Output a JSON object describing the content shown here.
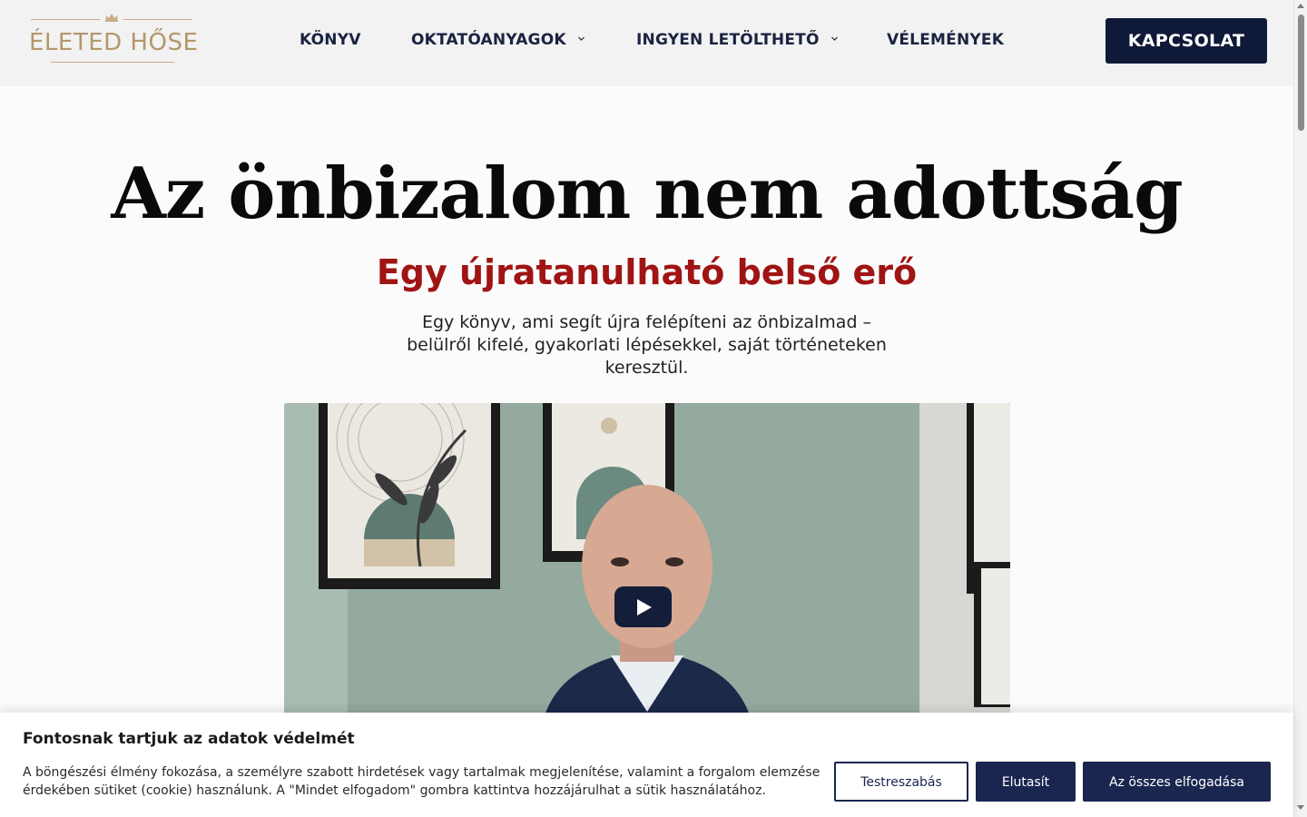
{
  "header": {
    "logo_text": "ÉLETED HŐSE",
    "nav": [
      {
        "label": "KÖNYV"
      },
      {
        "label": "OKTATÓANYAGOK"
      },
      {
        "label": "INGYEN LETÖLTHETŐ"
      },
      {
        "label": "VÉLEMÉNYEK"
      }
    ],
    "contact_label": "KAPCSOLAT"
  },
  "hero": {
    "title": "Az önbizalom nem adottság",
    "subtitle": "Egy újratanulható belső erő",
    "description": "Egy könyv, ami segít újra felépíteni az önbizalmad – belülről kifelé, gyakorlati lépésekkel, saját történeteken keresztül."
  },
  "cookie": {
    "title": "Fontosnak tartjuk az adatok védelmét",
    "text": "A böngészési élmény fokozása, a személyre szabott hirdetések vagy tartalmak megjelenítése, valamint a forgalom elemzése érdekében sütiket (cookie) használunk. A \"Mindet elfogadom\" gombra kattintva hozzájárulhat a sütik használatához.",
    "customize_label": "Testreszabás",
    "reject_label": "Elutasít",
    "accept_label": "Az összes elfogadása"
  },
  "colors": {
    "navy": "#0f1938",
    "accent_red": "#a01414",
    "logo_gold": "#b4976b"
  }
}
